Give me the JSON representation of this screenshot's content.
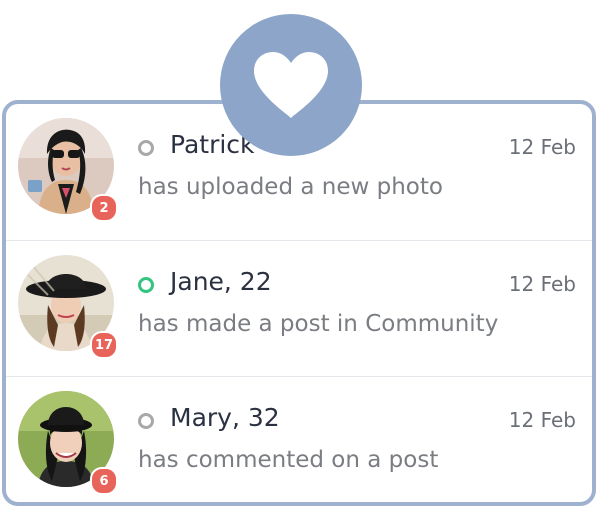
{
  "notifications": [
    {
      "name": "Patrick",
      "status": "offline",
      "date": "12 Feb",
      "activity": "has uploaded a new photo",
      "badge": "2"
    },
    {
      "name": "Jane, 22",
      "status": "online",
      "date": "12 Feb",
      "activity": "has made a post in Community",
      "badge": "17"
    },
    {
      "name": "Mary, 32",
      "status": "offline",
      "date": "12 Feb",
      "activity": "has commented on a post",
      "badge": "6"
    }
  ],
  "header_icon": "heart-icon",
  "colors": {
    "frame": "#9eb1cf",
    "heart_circle": "#8da5c9",
    "badge": "#e8645a",
    "online": "#33c47f",
    "offline": "#a8a8a8"
  }
}
